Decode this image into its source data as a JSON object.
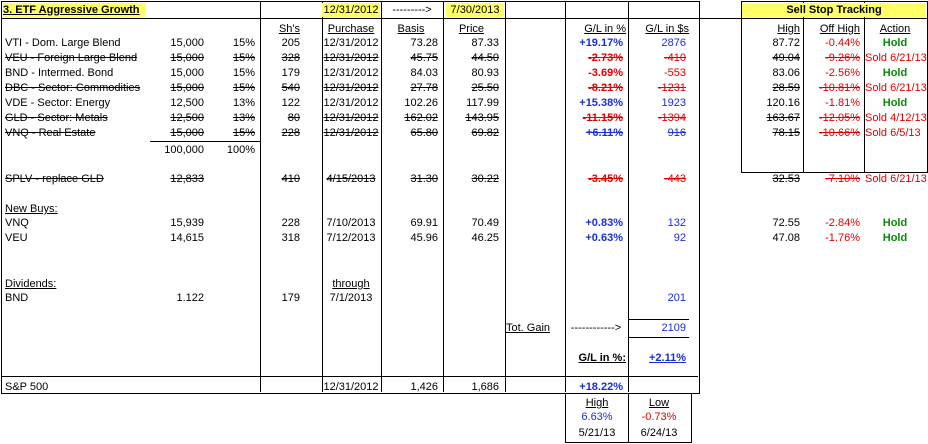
{
  "title": "3. ETF Aggressive Growth",
  "header": {
    "date_start": "12/31/2012",
    "arrow": "--------->",
    "date_end": "7/30/2013",
    "cols": [
      "Sh's",
      "Purchase",
      "Basis",
      "Price",
      "G/L in %",
      "G/L in $s"
    ],
    "sell_stop_title": "Sell Stop Tracking",
    "sell_cols": [
      "High",
      "Off High",
      "Action"
    ]
  },
  "holdings": [
    {
      "name": "VTI - Dom. Large Blend",
      "amount": "15,000",
      "pct": "15%",
      "shares": "205",
      "purchase": "12/31/2012",
      "basis": "73.28",
      "price": "87.33",
      "gl_pct": "+19.17%",
      "gl_usd": "2876",
      "high": "87.72",
      "off_high": "-0.44%",
      "action": "Hold"
    },
    {
      "name": "VEU - Foreign Large Blend",
      "amount": "15,000",
      "pct": "15%",
      "shares": "328",
      "purchase": "12/31/2012",
      "basis": "45.75",
      "price": "44.50",
      "gl_pct": "-2.73%",
      "gl_usd": "-410",
      "high": "49.04",
      "off_high": "-9.26%",
      "action": "Sold 6/21/13"
    },
    {
      "name": "BND - Intermed. Bond",
      "amount": "15,000",
      "pct": "15%",
      "shares": "179",
      "purchase": "12/31/2012",
      "basis": "84.03",
      "price": "80.93",
      "gl_pct": "-3.69%",
      "gl_usd": "-553",
      "high": "83.06",
      "off_high": "-2.56%",
      "action": "Hold"
    },
    {
      "name": "DBC - Sector: Commodities",
      "amount": "15,000",
      "pct": "15%",
      "shares": "540",
      "purchase": "12/31/2012",
      "basis": "27.78",
      "price": "25.50",
      "gl_pct": "-8.21%",
      "gl_usd": "-1231",
      "high": "28.59",
      "off_high": "-10.81%",
      "action": "Sold 6/21/13"
    },
    {
      "name": "VDE - Sector: Energy",
      "amount": "12,500",
      "pct": "13%",
      "shares": "122",
      "purchase": "12/31/2012",
      "basis": "102.26",
      "price": "117.99",
      "gl_pct": "+15.38%",
      "gl_usd": "1923",
      "high": "120.16",
      "off_high": "-1.81%",
      "action": "Hold"
    },
    {
      "name": "GLD - Sector: Metals",
      "amount": "12,500",
      "pct": "13%",
      "shares": "80",
      "purchase": "12/31/2012",
      "basis": "162.02",
      "price": "143.95",
      "gl_pct": "-11.15%",
      "gl_usd": "-1394",
      "high": "163.67",
      "off_high": "-12.05%",
      "action": "Sold 4/12/13"
    },
    {
      "name": "VNQ - Real Estate",
      "amount": "15,000",
      "pct": "15%",
      "shares": "228",
      "purchase": "12/31/2012",
      "basis": "65.80",
      "price": "69.82",
      "gl_pct": "+6.11%",
      "gl_usd": "916",
      "high": "78.15",
      "off_high": "-10.66%",
      "action": "Sold 6/5/13"
    }
  ],
  "totals": {
    "amount": "100,000",
    "pct": "100%"
  },
  "splv": {
    "name": "SPLV - replace GLD",
    "amount": "12,833",
    "shares": "410",
    "purchase": "4/15/2013",
    "basis": "31.30",
    "price": "30.22",
    "gl_pct": "-3.45%",
    "gl_usd": "-443",
    "high": "32.53",
    "off_high": "-7.10%",
    "action": "Sold 6/21/13"
  },
  "new_buys_label": "New Buys:",
  "new_buys": [
    {
      "name": "VNQ",
      "amount": "15,939",
      "shares": "228",
      "purchase": "7/10/2013",
      "basis": "69.91",
      "price": "70.49",
      "gl_pct": "+0.83%",
      "gl_usd": "132",
      "high": "72.55",
      "off_high": "-2.84%",
      "action": "Hold"
    },
    {
      "name": "VEU",
      "amount": "14,615",
      "shares": "318",
      "purchase": "7/12/2013",
      "basis": "45.96",
      "price": "46.25",
      "gl_pct": "+0.63%",
      "gl_usd": "92",
      "high": "47.08",
      "off_high": "-1.76%",
      "action": "Hold"
    }
  ],
  "dividends_label": "Dividends:",
  "dividends": {
    "through_label": "through",
    "name": "BND",
    "amount": "1.122",
    "shares": "179",
    "date": "7/1/2013",
    "value": "201"
  },
  "tot_gain": {
    "label": "Tot. Gain",
    "arrow": "------------>",
    "value": "2109"
  },
  "gl_pct": {
    "label": "G/L in %:",
    "value": "+2.11%"
  },
  "sp500": {
    "name": "S&P 500",
    "date": "12/31/2012",
    "basis": "1,426",
    "price": "1,686",
    "gl_pct": "+18.22%"
  },
  "hilo": {
    "high_label": "High",
    "low_label": "Low",
    "high_value": "6.63%",
    "low_value": "-0.73%",
    "high_date": "5/21/13",
    "low_date": "6/24/13"
  }
}
